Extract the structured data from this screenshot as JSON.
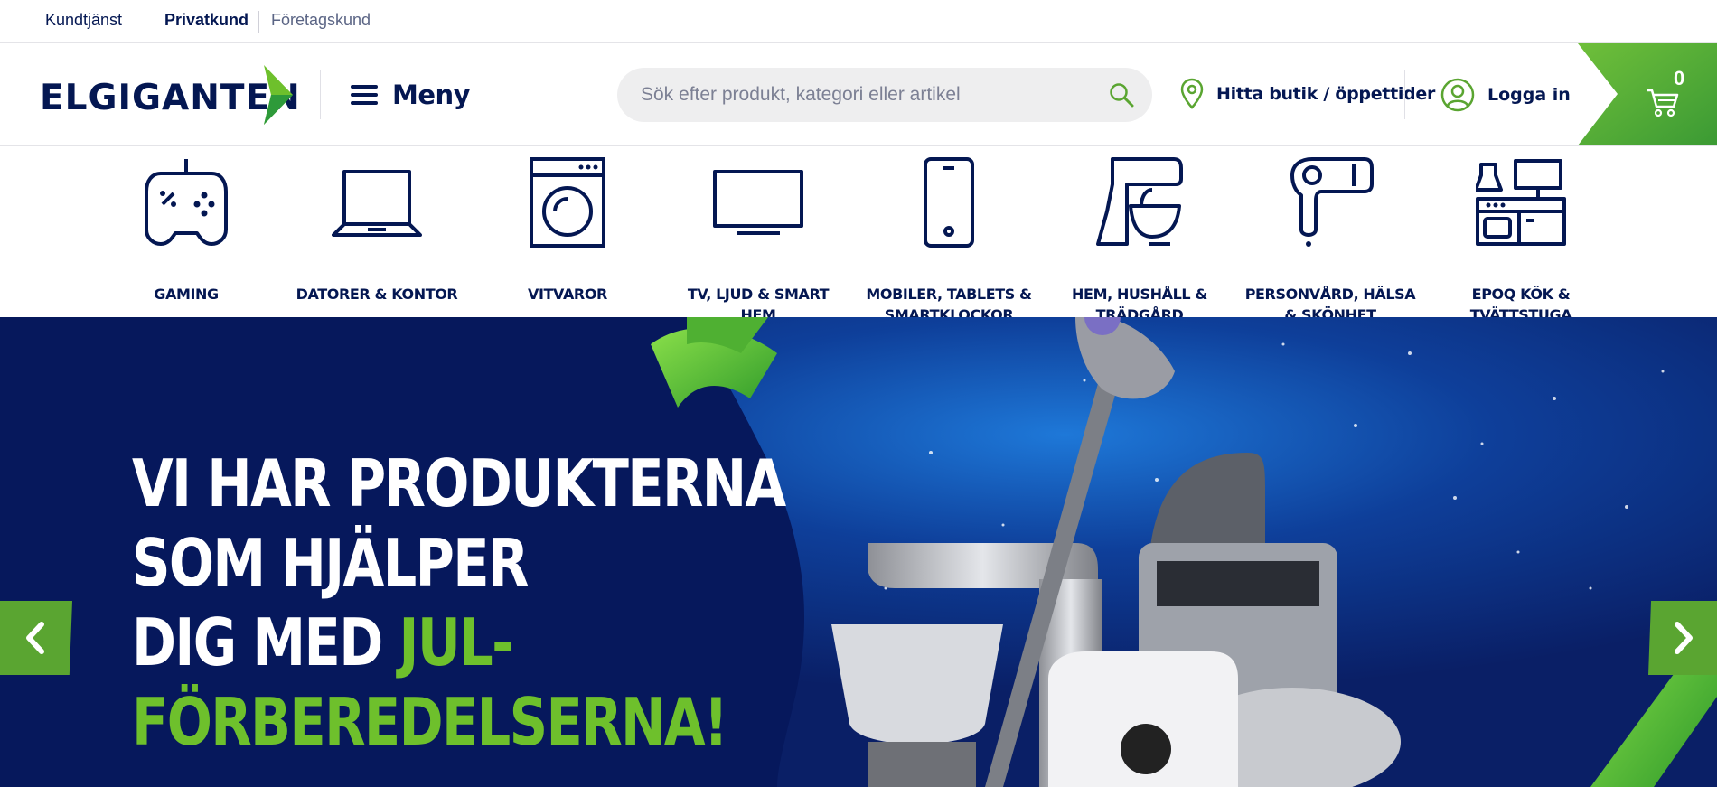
{
  "topbar": {
    "links": [
      "Kundtjänst",
      "Privatkund",
      "Företagskund"
    ]
  },
  "header": {
    "logo_text": "ELGIGANTEN",
    "menu_label": "Meny",
    "search": {
      "placeholder": "Sök efter produkt, kategori eller artikel",
      "value": ""
    },
    "store_label": "Hitta butik / öppettider",
    "login_label": "Logga in",
    "cart_count": "0"
  },
  "categories": [
    {
      "label": "GAMING",
      "icon": "gamepad-icon"
    },
    {
      "label": "DATORER & KONTOR",
      "icon": "laptop-icon"
    },
    {
      "label": "VITVAROR",
      "icon": "washing-machine-icon"
    },
    {
      "label": "TV, LJUD & SMART HEM",
      "icon": "tv-icon"
    },
    {
      "label": "MOBILER, TABLETS & SMARTKLOCKOR",
      "icon": "smartphone-icon"
    },
    {
      "label": "HEM, HUSHÅLL & TRÄDGÅRD",
      "icon": "stand-mixer-icon"
    },
    {
      "label": "PERSONVÅRD, HÄLSA & SKÖNHET",
      "icon": "hair-dryer-icon"
    },
    {
      "label": "EPOQ KÖK & TVÄTTSTUGA",
      "icon": "kitchen-icon"
    }
  ],
  "hero": {
    "line1": "VI HAR PRODUKTERNA",
    "line2": "SOM HJÄLPER",
    "line3_white": "DIG MED ",
    "line3_green": "JUL-",
    "line4": "FÖRBEREDELSERNA!"
  },
  "colors": {
    "brand_navy": "#041752",
    "brand_green": "#5aa531",
    "hero_bg": "#06185c",
    "accent_green_text": "#6ec02c"
  }
}
